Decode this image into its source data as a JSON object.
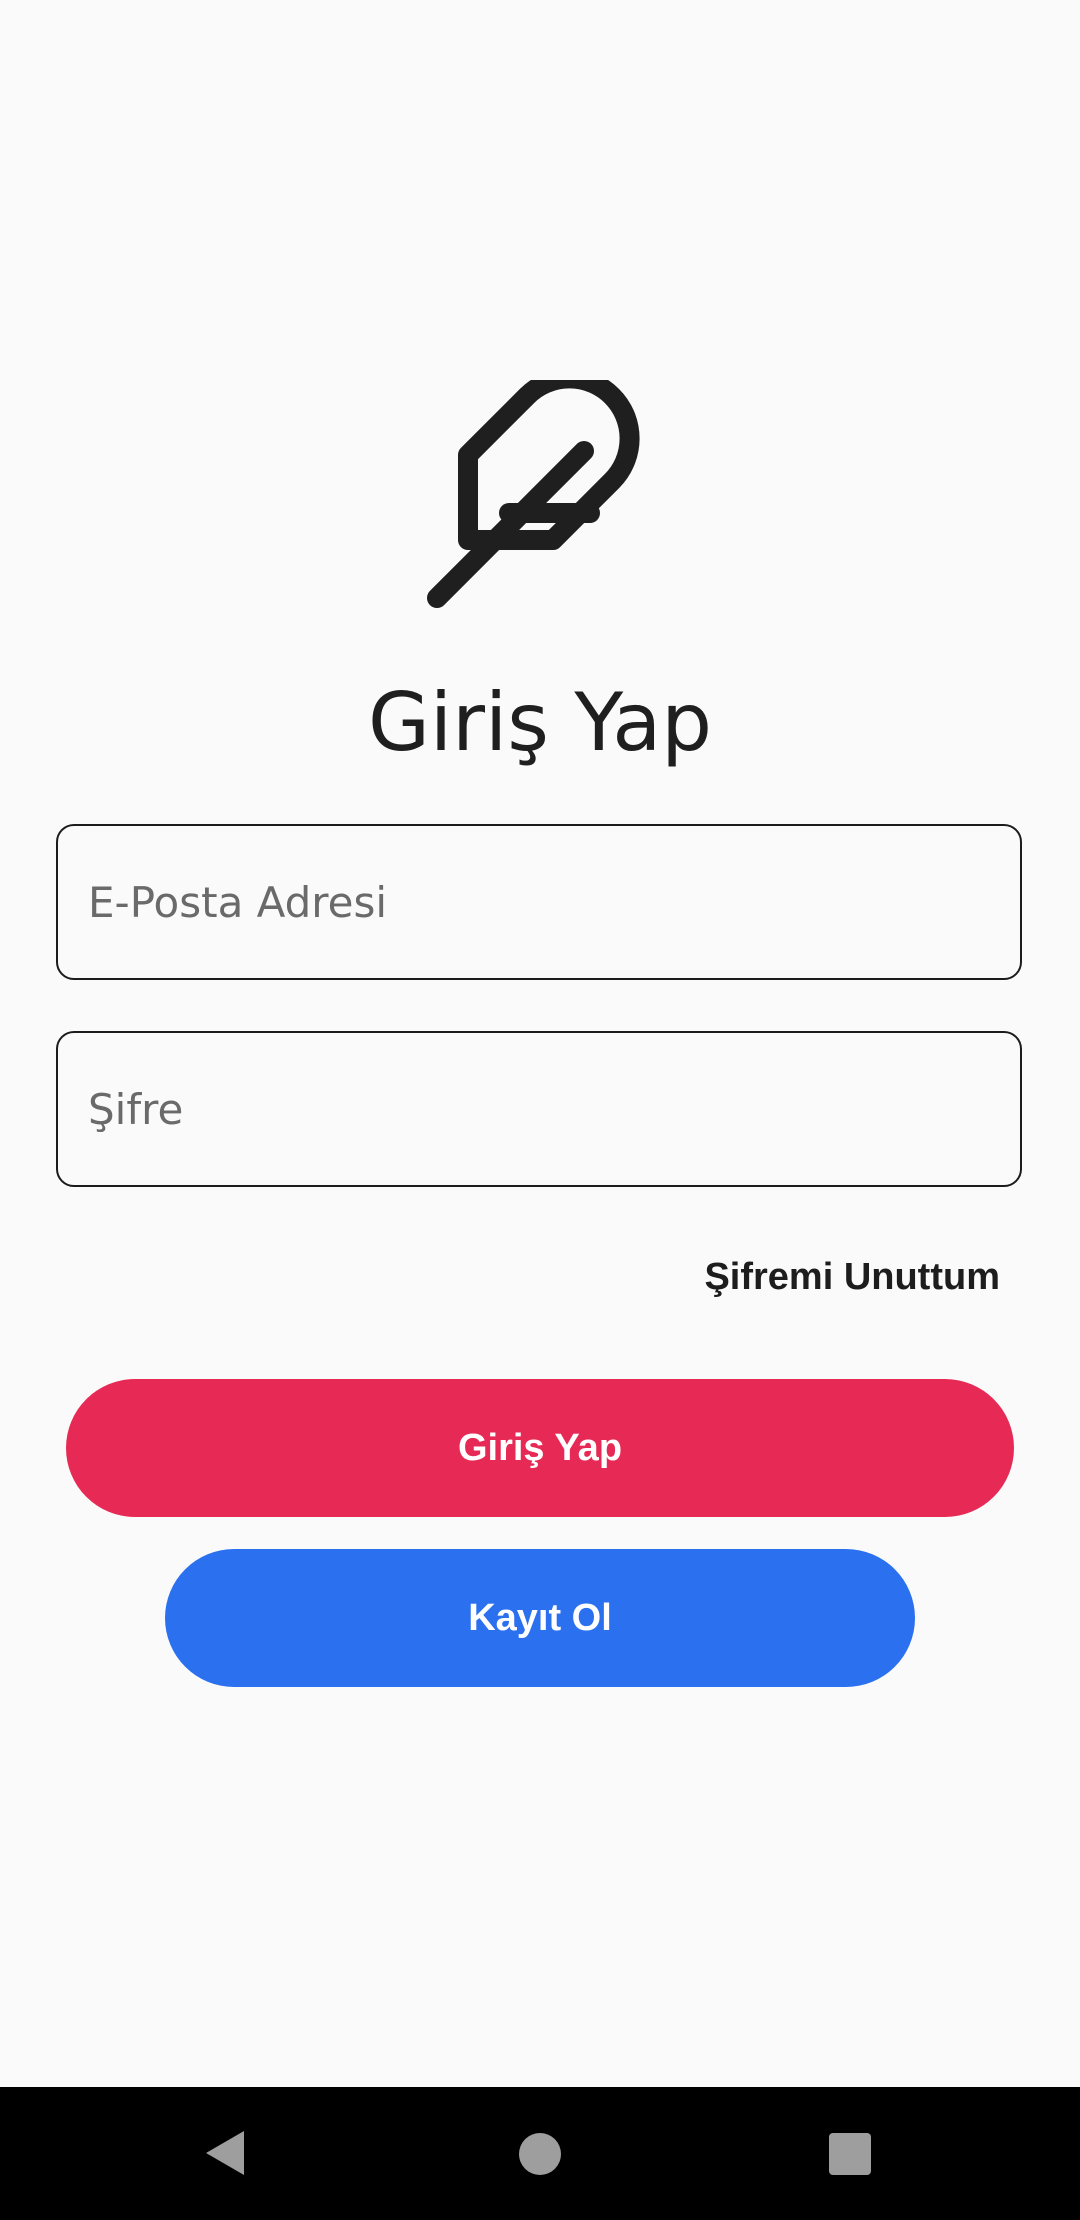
{
  "login": {
    "title": "Giriş Yap",
    "email": {
      "placeholder": "E-Posta Adresi",
      "value": ""
    },
    "password": {
      "placeholder": "Şifre",
      "value": ""
    },
    "forgot_label": "Şifremi Unuttum",
    "login_button": "Giriş Yap",
    "register_button": "Kayıt Ol"
  },
  "icons": {
    "logo": "feather-icon",
    "nav_back": "back-triangle-icon",
    "nav_home": "home-circle-icon",
    "nav_recent": "recent-apps-square-icon"
  },
  "colors": {
    "background": "#fafafa",
    "login_button": "#e72a55",
    "register_button": "#2b71ef",
    "text_dark": "#1f1f1f",
    "navbar": "#000000",
    "nav_icons": "#9e9e9e"
  }
}
